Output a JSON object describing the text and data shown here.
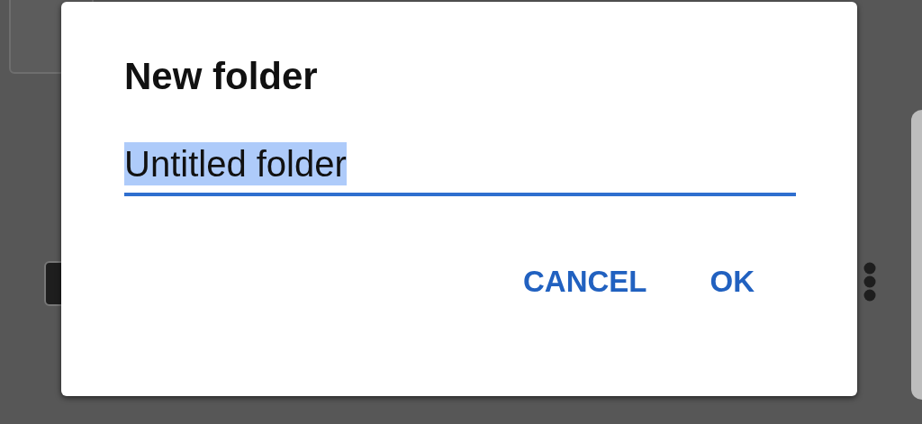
{
  "dialog": {
    "title": "New folder",
    "field": {
      "value": "Untitled folder",
      "text_selected": true,
      "focused": true
    },
    "buttons": [
      {
        "label": "CANCEL"
      },
      {
        "label": "OK"
      }
    ]
  }
}
